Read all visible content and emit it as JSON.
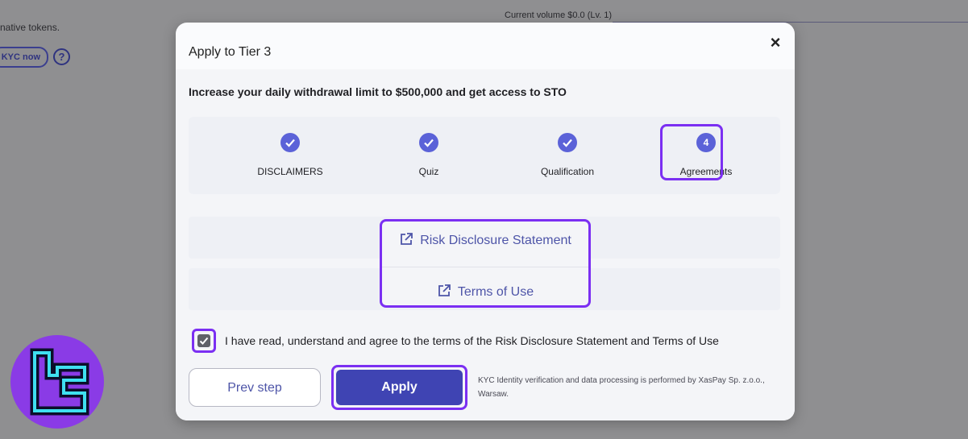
{
  "background": {
    "tokens_text": "native tokens.",
    "volume_text": "Current volume $0.0 (Lv. 1)",
    "kyc_button": "KYC now",
    "help_icon": "?"
  },
  "modal": {
    "title": "Apply to Tier 3",
    "close_icon": "×",
    "subtitle": "Increase your daily withdrawal limit to $500,000 and get access to STO",
    "steps": [
      {
        "label": "DISCLAIMERS",
        "state": "done"
      },
      {
        "label": "Quiz",
        "state": "done"
      },
      {
        "label": "Qualification",
        "state": "done"
      },
      {
        "label": "Agreements",
        "state": "current",
        "number": "4"
      }
    ],
    "documents": [
      {
        "label": "Risk Disclosure Statement",
        "icon": "external-link-icon"
      },
      {
        "label": "Terms of Use",
        "icon": "external-link-icon"
      }
    ],
    "agreement": {
      "checked": true,
      "text": "I have read, understand and agree to the terms of the Risk Disclosure Statement and Terms of Use"
    },
    "prev_button": "Prev step",
    "apply_button": "Apply",
    "kyc_note": "KYC Identity verification and data processing is performed by XasPay Sp. z.o.o., Warsaw."
  },
  "colors": {
    "accent": "#5b62d8",
    "highlight": "#7b2ff2",
    "primary_button": "#3f44b3",
    "link": "#4e55a8"
  }
}
